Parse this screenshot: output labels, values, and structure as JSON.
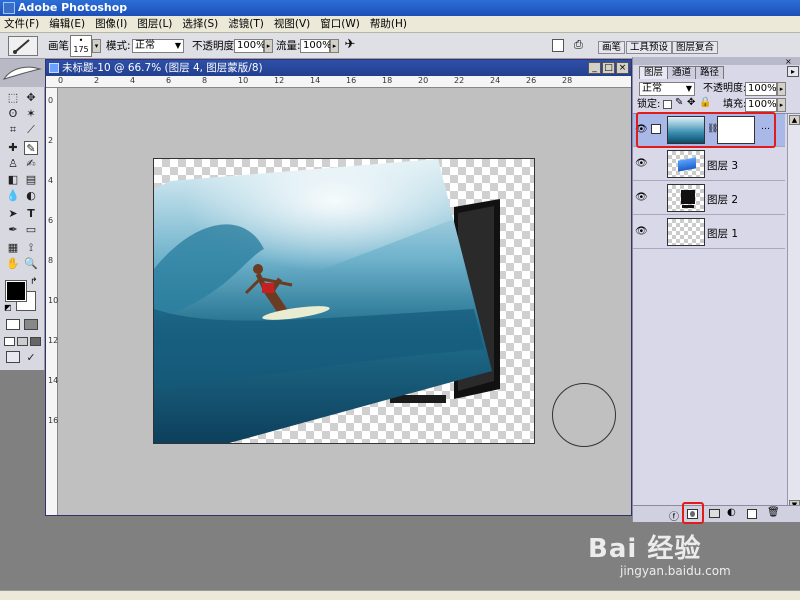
{
  "window": {
    "title": "Adobe Photoshop"
  },
  "menu": [
    "文件(F)",
    "编辑(E)",
    "图像(I)",
    "图层(L)",
    "选择(S)",
    "滤镜(T)",
    "视图(V)",
    "窗口(W)",
    "帮助(H)"
  ],
  "options": {
    "brush_label": "画笔:",
    "brush_size": "175",
    "mode_label": "模式:",
    "mode_value": "正常",
    "opacity_label": "不透明度:",
    "opacity_value": "100%",
    "flow_label": "流量:",
    "flow_value": "100%",
    "dock_tabs": [
      "画笔",
      "工具预设",
      "图层复合"
    ]
  },
  "document": {
    "title": "未标题-10 @ 66.7% (图层 4, 图层蒙版/8)",
    "ruler_top": [
      "0",
      "2",
      "4",
      "6",
      "8",
      "10",
      "12",
      "14",
      "16",
      "18",
      "20",
      "22",
      "24",
      "26",
      "28"
    ],
    "ruler_left": [
      "0",
      "2",
      "4",
      "6",
      "8",
      "10",
      "12",
      "14",
      "16"
    ]
  },
  "layers_panel": {
    "tabs": [
      "图层",
      "通道",
      "路径"
    ],
    "blend_mode": "正常",
    "opacity_label": "不透明度:",
    "opacity_value": "100%",
    "lock_label": "锁定:",
    "fill_label": "填充:",
    "fill_value": "100%",
    "layers": [
      {
        "name": "",
        "thumb": "surf-photo",
        "has_mask": true,
        "active": true
      },
      {
        "name": "图层 3",
        "thumb": "blue-sky",
        "has_mask": false,
        "active": false
      },
      {
        "name": "图层 2",
        "thumb": "monitor",
        "has_mask": false,
        "active": false
      },
      {
        "name": "图层 1",
        "thumb": "transparent",
        "has_mask": false,
        "active": false
      }
    ]
  },
  "watermark": {
    "brand": "Bai 经验",
    "url": "jingyan.baidu.com"
  },
  "colors": {
    "highlight_red": "#e21b1b",
    "titlebar_blue": "#1d4fb8"
  }
}
